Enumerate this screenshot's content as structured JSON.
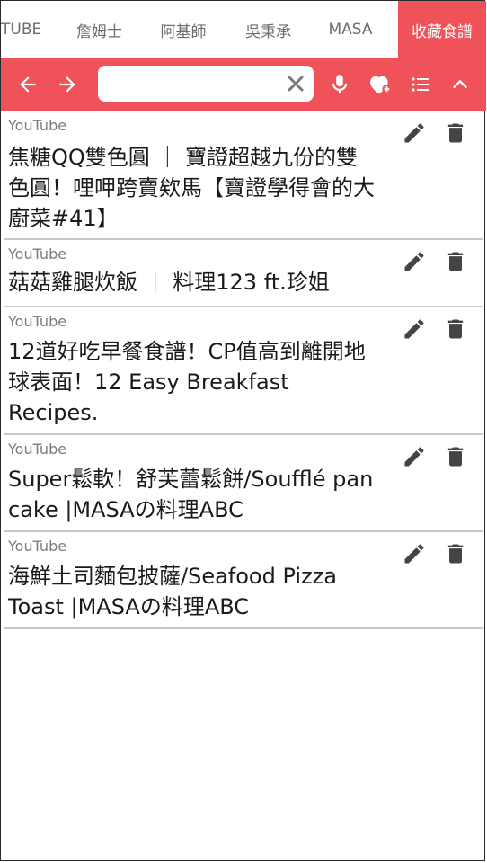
{
  "tabs": [
    {
      "label": "TUBE"
    },
    {
      "label": "詹姆士"
    },
    {
      "label": "阿基師"
    },
    {
      "label": "吳秉承"
    },
    {
      "label": "MASA"
    },
    {
      "label": "收藏食譜",
      "active": true
    }
  ],
  "toolbar": {
    "search": {
      "value": "",
      "placeholder": ""
    }
  },
  "items": [
    {
      "source": "YouTube",
      "title": "焦糖QQ雙色圓 ｜ 寶證超越九份的雙色圓！哩呷跨賣欸馬【寶證學得會的大廚菜#41】"
    },
    {
      "source": "YouTube",
      "title": "菇菇雞腿炊飯 ｜ 料理123 ft.珍姐"
    },
    {
      "source": "YouTube",
      "title": "12道好吃早餐食譜！CP值高到離開地球表面！12 Easy Breakfast Recipes."
    },
    {
      "source": "YouTube",
      "title": "Super鬆軟！舒芙蕾鬆餅/Soufflé pan cake |MASAの料理ABC"
    },
    {
      "source": "YouTube",
      "title": "海鮮土司麵包披薩/Seafood Pizza Toast |MASAの料理ABC"
    }
  ],
  "colors": {
    "accent": "#f0525a",
    "icon": "#444444"
  }
}
